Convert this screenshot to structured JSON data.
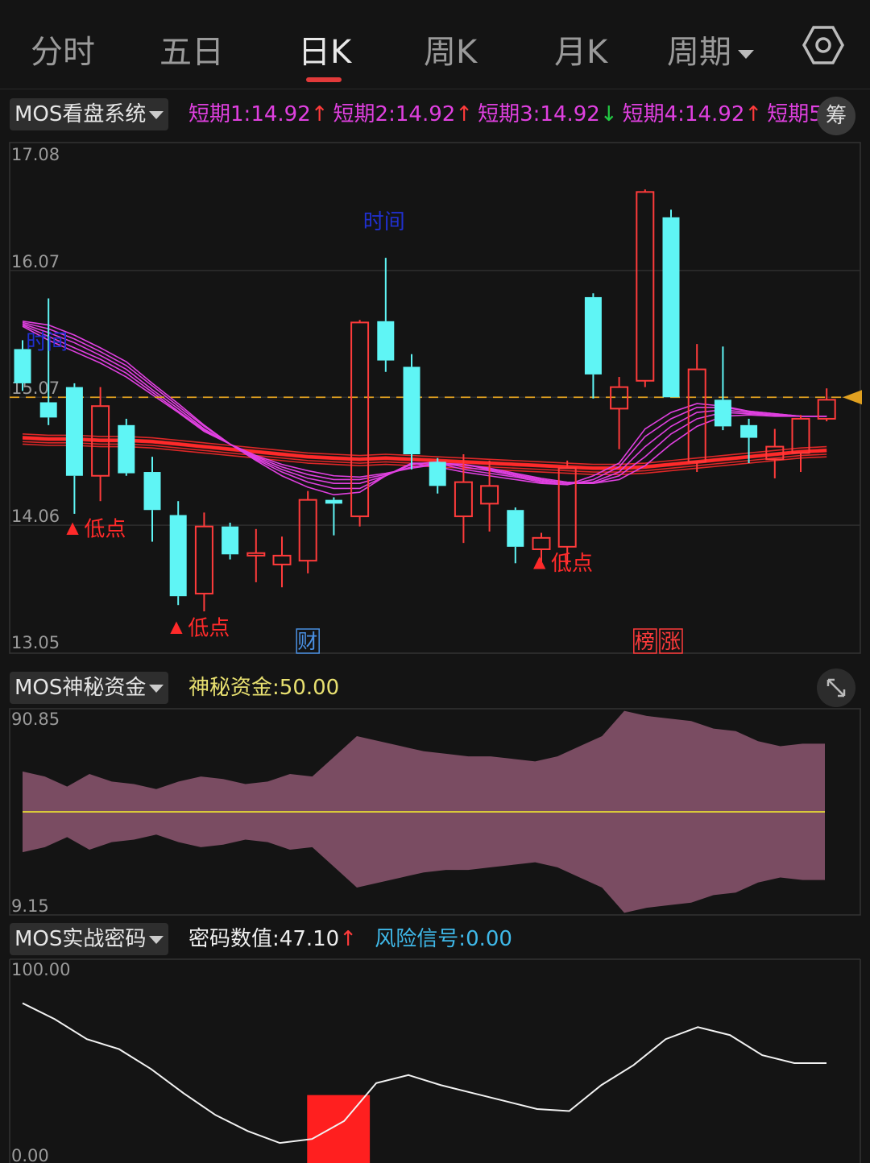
{
  "tabs": [
    {
      "label": "分时",
      "active": false
    },
    {
      "label": "五日",
      "active": false
    },
    {
      "label": "日K",
      "active": true
    },
    {
      "label": "周K",
      "active": false
    },
    {
      "label": "月K",
      "active": false
    },
    {
      "label": "周期",
      "active": false,
      "dropdown": true
    }
  ],
  "settings_icon": "hexagon-gear-icon",
  "main_panel": {
    "selector": "MOS看盘系统",
    "legend": [
      {
        "label": "短期1",
        "value": "14.92",
        "arrow": "↑",
        "color": "#e040e0",
        "arrow_color": "#ff3b3b"
      },
      {
        "label": "短期2",
        "value": "14.92",
        "arrow": "↑",
        "color": "#e040e0",
        "arrow_color": "#ff3b3b"
      },
      {
        "label": "短期3",
        "value": "14.92",
        "arrow": "↓",
        "color": "#e040e0",
        "arrow_color": "#22cc44"
      },
      {
        "label": "短期4",
        "value": "14.92",
        "arrow": "↑",
        "color": "#e040e0",
        "arrow_color": "#ff3b3b"
      },
      {
        "label": "短期5",
        "value": "",
        "arrow": "",
        "color": "#e040e0",
        "arrow_color": "#ff3b3b"
      }
    ],
    "chip_button": "筹",
    "colors": {
      "up": "#ff3b3b",
      "down": "#5ff5f5",
      "ma": "#e040e0",
      "long_ma": "#ff2a2a",
      "price_line": "#e0a020"
    }
  },
  "sub_panel_1": {
    "selector": "MOS神秘资金",
    "legend": {
      "label": "神秘资金",
      "value": "50.00",
      "color": "#e8e070"
    },
    "expand_icon": "expand-arrows-icon"
  },
  "sub_panel_2": {
    "selector": "MOS实战密码",
    "legend": [
      {
        "label": "密码数值",
        "value": "47.10",
        "arrow": "↑",
        "color": "#eeeeee",
        "arrow_color": "#ff3b3b"
      },
      {
        "label": "风险信号",
        "value": "0.00",
        "arrow": "",
        "color": "#3fb8e8",
        "arrow_color": ""
      }
    ]
  },
  "chart_data": [
    {
      "type": "candlestick",
      "y_ticks": [
        "17.08",
        "16.07",
        "15.07",
        "14.06",
        "13.05"
      ],
      "ylim": [
        13.05,
        17.08
      ],
      "grid": true,
      "current_price": 15.07,
      "candles": [
        {
          "o": 15.45,
          "c": 15.18,
          "h": 15.52,
          "l": 15.12
        },
        {
          "o": 15.03,
          "c": 14.91,
          "h": 15.85,
          "l": 14.85
        },
        {
          "o": 15.15,
          "c": 14.45,
          "h": 15.18,
          "l": 14.15
        },
        {
          "o": 14.45,
          "c": 15.0,
          "h": 15.15,
          "l": 14.25
        },
        {
          "o": 14.85,
          "c": 14.47,
          "h": 14.9,
          "l": 14.45
        },
        {
          "o": 14.48,
          "c": 14.18,
          "h": 14.6,
          "l": 13.93
        },
        {
          "o": 14.14,
          "c": 13.5,
          "h": 14.25,
          "l": 13.43
        },
        {
          "o": 13.52,
          "c": 14.05,
          "h": 14.16,
          "l": 13.38
        },
        {
          "o": 14.05,
          "c": 13.83,
          "h": 14.08,
          "l": 13.79
        },
        {
          "o": 13.82,
          "c": 13.84,
          "h": 14.03,
          "l": 13.61
        },
        {
          "o": 13.75,
          "c": 13.82,
          "h": 13.97,
          "l": 13.57
        },
        {
          "o": 13.78,
          "c": 14.26,
          "h": 14.33,
          "l": 13.68
        },
        {
          "o": 14.26,
          "c": 14.23,
          "h": 14.28,
          "l": 13.98
        },
        {
          "o": 14.13,
          "c": 15.66,
          "h": 15.68,
          "l": 14.05
        },
        {
          "o": 15.67,
          "c": 15.36,
          "h": 16.17,
          "l": 15.27
        },
        {
          "o": 15.31,
          "c": 14.62,
          "h": 15.41,
          "l": 14.5
        },
        {
          "o": 14.56,
          "c": 14.37,
          "h": 14.59,
          "l": 14.31
        },
        {
          "o": 14.13,
          "c": 14.4,
          "h": 14.62,
          "l": 13.92
        },
        {
          "o": 14.23,
          "c": 14.37,
          "h": 14.57,
          "l": 14.01
        },
        {
          "o": 14.18,
          "c": 13.89,
          "h": 14.2,
          "l": 13.76
        },
        {
          "o": 13.87,
          "c": 13.96,
          "h": 14.0,
          "l": 13.72
        },
        {
          "o": 13.89,
          "c": 14.51,
          "h": 14.57,
          "l": 13.75
        },
        {
          "o": 15.86,
          "c": 15.25,
          "h": 15.89,
          "l": 15.06
        },
        {
          "o": 14.98,
          "c": 15.15,
          "h": 15.23,
          "l": 14.66
        },
        {
          "o": 15.2,
          "c": 16.69,
          "h": 16.71,
          "l": 15.15
        },
        {
          "o": 16.49,
          "c": 15.07,
          "h": 16.55,
          "l": 15.07
        },
        {
          "o": 14.56,
          "c": 15.29,
          "h": 15.49,
          "l": 14.48
        },
        {
          "o": 15.05,
          "c": 14.84,
          "h": 15.47,
          "l": 14.81
        },
        {
          "o": 14.85,
          "c": 14.75,
          "h": 14.9,
          "l": 14.55
        },
        {
          "o": 14.58,
          "c": 14.68,
          "h": 14.82,
          "l": 14.43
        },
        {
          "o": 14.63,
          "c": 14.9,
          "h": 14.93,
          "l": 14.48
        },
        {
          "o": 14.9,
          "c": 15.05,
          "h": 15.14,
          "l": 14.88
        }
      ],
      "ma_short": [
        [
          15.67,
          15.64,
          15.56,
          15.46,
          15.35,
          15.18,
          15.02,
          14.85,
          14.7,
          14.57,
          14.45,
          14.36,
          14.3,
          14.32,
          14.45,
          14.55,
          14.52,
          14.48,
          14.45,
          14.42,
          14.39,
          14.38,
          14.45,
          14.55,
          14.82,
          14.95,
          15.02,
          15.0,
          14.96,
          14.94,
          14.92,
          14.92
        ],
        [
          15.66,
          15.61,
          15.53,
          15.43,
          15.32,
          15.16,
          15.0,
          14.84,
          14.7,
          14.58,
          14.48,
          14.4,
          14.35,
          14.35,
          14.45,
          14.55,
          14.55,
          14.5,
          14.47,
          14.44,
          14.4,
          14.38,
          14.42,
          14.52,
          14.76,
          14.9,
          14.99,
          14.99,
          14.96,
          14.94,
          14.92,
          14.92
        ],
        [
          15.65,
          15.58,
          15.5,
          15.4,
          15.29,
          15.13,
          14.98,
          14.82,
          14.7,
          14.59,
          14.5,
          14.43,
          14.39,
          14.39,
          14.45,
          14.54,
          14.56,
          14.52,
          14.49,
          14.45,
          14.41,
          14.39,
          14.4,
          14.48,
          14.68,
          14.84,
          14.95,
          14.97,
          14.95,
          14.93,
          14.92,
          14.92
        ],
        [
          15.64,
          15.55,
          15.46,
          15.37,
          15.26,
          15.11,
          14.96,
          14.81,
          14.7,
          14.6,
          14.52,
          14.46,
          14.42,
          14.42,
          14.46,
          14.52,
          14.55,
          14.54,
          14.5,
          14.46,
          14.42,
          14.39,
          14.39,
          14.45,
          14.6,
          14.78,
          14.9,
          14.95,
          14.94,
          14.93,
          14.92,
          14.92
        ],
        [
          15.63,
          15.52,
          15.43,
          15.34,
          15.23,
          15.09,
          14.95,
          14.8,
          14.7,
          14.61,
          14.54,
          14.49,
          14.45,
          14.44,
          14.47,
          14.51,
          14.54,
          14.54,
          14.51,
          14.47,
          14.43,
          14.4,
          14.39,
          14.42,
          14.53,
          14.7,
          14.84,
          14.92,
          14.93,
          14.92,
          14.92,
          14.92
        ]
      ],
      "ma_long": [
        14.75,
        14.74,
        14.74,
        14.73,
        14.73,
        14.72,
        14.7,
        14.68,
        14.66,
        14.64,
        14.62,
        14.6,
        14.59,
        14.58,
        14.59,
        14.58,
        14.57,
        14.56,
        14.55,
        14.54,
        14.53,
        14.52,
        14.51,
        14.51,
        14.52,
        14.54,
        14.56,
        14.58,
        14.6,
        14.62,
        14.64,
        14.65
      ],
      "annotations": [
        {
          "text": "时间",
          "index": 14,
          "price": 16.4,
          "color": "#2030d0"
        },
        {
          "text": "时间",
          "index": 1,
          "price": 15.45,
          "color": "#2030d0"
        },
        {
          "text": "低点",
          "index": 2,
          "price": 14.05,
          "color": "#ff2a2a",
          "marker": "▲"
        },
        {
          "text": "低点",
          "index": 6,
          "price": 13.27,
          "color": "#ff2a2a",
          "marker": "▲"
        },
        {
          "text": "低点",
          "index": 20,
          "price": 13.78,
          "color": "#ff2a2a",
          "marker": "▲"
        }
      ],
      "events": [
        {
          "text": "财",
          "index": 11,
          "color": "#4a90e2"
        },
        {
          "text": "榜",
          "index": 24,
          "color": "#ff3b3b"
        },
        {
          "text": "涨",
          "index": 25,
          "color": "#ff3b3b"
        }
      ]
    },
    {
      "type": "area",
      "y_ticks": [
        "90.85",
        "9.15"
      ],
      "ylim": [
        9.15,
        90.85
      ],
      "baseline": 50.0,
      "upper": [
        66,
        64,
        60,
        65,
        62,
        61,
        59,
        62,
        64,
        63,
        61,
        62,
        65,
        64,
        72,
        80,
        78,
        76,
        74,
        73,
        72,
        72,
        71,
        70,
        72,
        76,
        80,
        90,
        88,
        87,
        86,
        83,
        82,
        78,
        76,
        77,
        77
      ],
      "lower": [
        34,
        36,
        40,
        35,
        38,
        39,
        41,
        38,
        36,
        37,
        39,
        38,
        35,
        36,
        28,
        20,
        22,
        24,
        26,
        27,
        27,
        28,
        29,
        30,
        28,
        24,
        20,
        10,
        12,
        13,
        14,
        17,
        18,
        22,
        24,
        23,
        23
      ]
    },
    {
      "type": "line",
      "y_ticks": [
        "100.00",
        "0.00"
      ],
      "ylim": [
        0,
        100
      ],
      "values": [
        78,
        70,
        60,
        55,
        45,
        33,
        22,
        14,
        8,
        10,
        19,
        38,
        42,
        37,
        33,
        29,
        25,
        24,
        37,
        47,
        60,
        66,
        62,
        52,
        48,
        48
      ],
      "risk_bar": {
        "from_index": 9,
        "to_index": 11,
        "value": 32
      }
    }
  ]
}
